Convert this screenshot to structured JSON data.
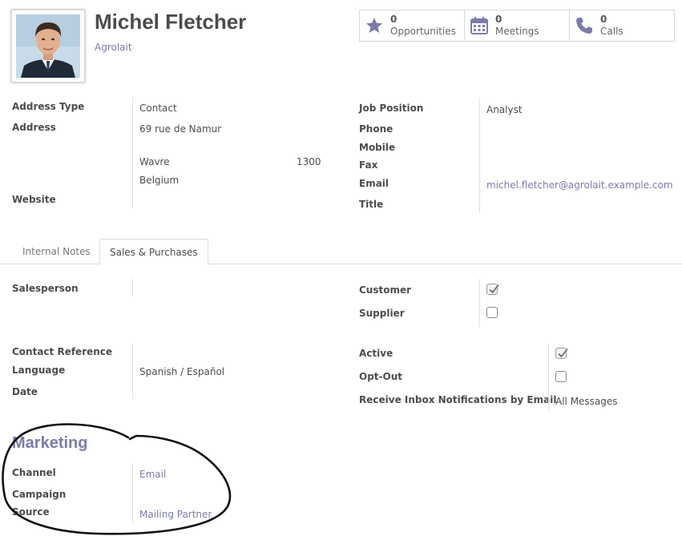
{
  "contact": {
    "name": "Michel Fletcher",
    "company": "Agrolait"
  },
  "smart_buttons": [
    {
      "count": "0",
      "label": "Opportunities",
      "icon": "star-icon"
    },
    {
      "count": "0",
      "label": "Meetings",
      "icon": "calendar-icon"
    },
    {
      "count": "0",
      "label": "Calls",
      "icon": "phone-icon"
    }
  ],
  "address": {
    "address_type_label": "Address Type",
    "address_type_value": "Contact",
    "address_label": "Address",
    "street": "69 rue de Namur",
    "city": "Wavre",
    "zip": "1300",
    "country": "Belgium",
    "website_label": "Website"
  },
  "job": {
    "job_position_label": "Job Position",
    "job_position_value": "Analyst",
    "phone_label": "Phone",
    "mobile_label": "Mobile",
    "fax_label": "Fax",
    "email_label": "Email",
    "email_value": "michel.fletcher@agrolait.example.com",
    "title_label": "Title"
  },
  "tabs": [
    {
      "label": "Internal Notes",
      "active": false
    },
    {
      "label": "Sales & Purchases",
      "active": true
    }
  ],
  "sales": {
    "salesperson_label": "Salesperson",
    "customer_label": "Customer",
    "customer_checked": true,
    "supplier_label": "Supplier",
    "supplier_checked": false,
    "contact_reference_label": "Contact Reference",
    "language_label": "Language",
    "language_value": "Spanish / Español",
    "date_label": "Date",
    "active_label": "Active",
    "active_checked": true,
    "opt_out_label": "Opt-Out",
    "opt_out_checked": false,
    "notifications_label": "Receive Inbox Notifications by Email",
    "notifications_value": "All Messages"
  },
  "marketing": {
    "title": "Marketing",
    "channel_label": "Channel",
    "channel_value": "Email",
    "campaign_label": "Campaign",
    "source_label": "Source",
    "source_value": "Mailing Partner"
  },
  "colors": {
    "accent": "#7c7bad",
    "text": "#4c4c4c",
    "border": "#dddddd"
  }
}
